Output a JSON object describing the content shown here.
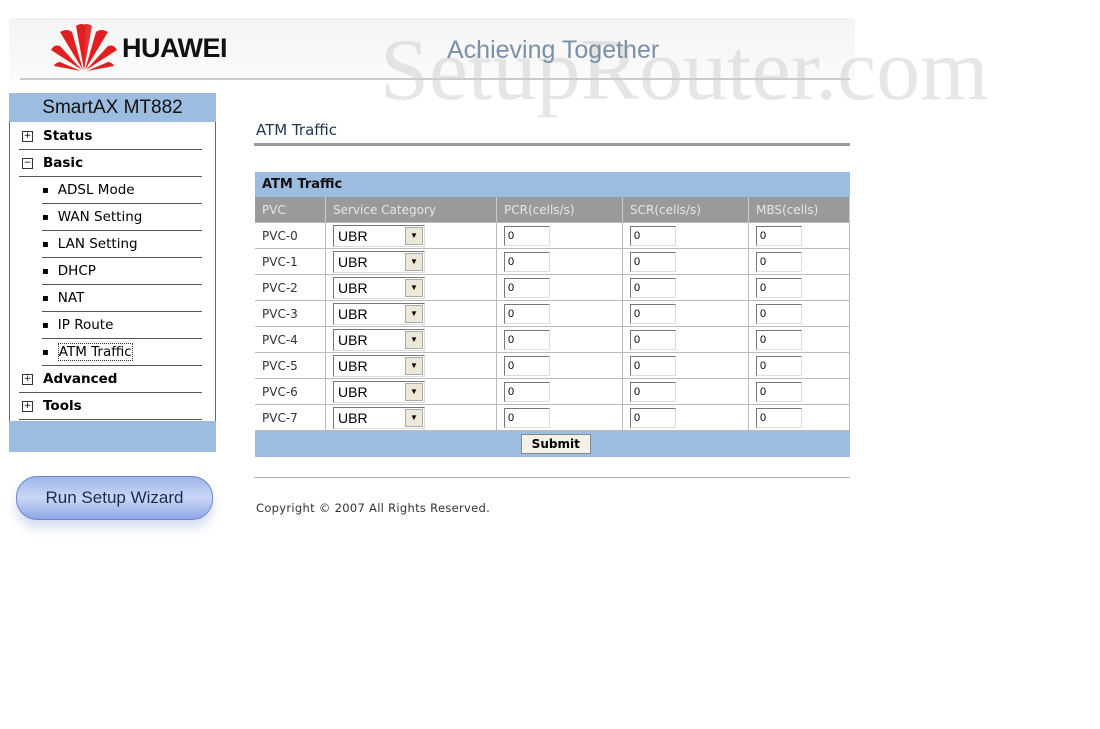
{
  "header": {
    "brand": "HUAWEI",
    "slogan": "Achieving Together",
    "watermark": "SetupRouter.com",
    "logo_color": "#e02020"
  },
  "sidebar": {
    "title": "SmartAX MT882",
    "items": [
      {
        "label": "Status",
        "icon": "plus",
        "type": "top"
      },
      {
        "label": "Basic",
        "icon": "minus",
        "type": "top"
      },
      {
        "label": "ADSL Mode",
        "type": "sub"
      },
      {
        "label": "WAN Setting",
        "type": "sub"
      },
      {
        "label": "LAN Setting",
        "type": "sub"
      },
      {
        "label": "DHCP",
        "type": "sub"
      },
      {
        "label": "NAT",
        "type": "sub"
      },
      {
        "label": "IP Route",
        "type": "sub"
      },
      {
        "label": "ATM Traffic",
        "type": "sub",
        "active": true
      },
      {
        "label": "Advanced",
        "icon": "plus",
        "type": "top"
      },
      {
        "label": "Tools",
        "icon": "plus",
        "type": "top"
      }
    ],
    "wizard_label": "Run Setup Wizard"
  },
  "main": {
    "title": "ATM Traffic",
    "table": {
      "caption": "ATM Traffic",
      "headers": [
        "PVC",
        "Service Category",
        "PCR(cells/s)",
        "SCR(cells/s)",
        "MBS(cells)"
      ],
      "rows": [
        {
          "pvc": "PVC-0",
          "category": "UBR",
          "pcr": "0",
          "scr": "0",
          "mbs": "0"
        },
        {
          "pvc": "PVC-1",
          "category": "UBR",
          "pcr": "0",
          "scr": "0",
          "mbs": "0"
        },
        {
          "pvc": "PVC-2",
          "category": "UBR",
          "pcr": "0",
          "scr": "0",
          "mbs": "0"
        },
        {
          "pvc": "PVC-3",
          "category": "UBR",
          "pcr": "0",
          "scr": "0",
          "mbs": "0"
        },
        {
          "pvc": "PVC-4",
          "category": "UBR",
          "pcr": "0",
          "scr": "0",
          "mbs": "0"
        },
        {
          "pvc": "PVC-5",
          "category": "UBR",
          "pcr": "0",
          "scr": "0",
          "mbs": "0"
        },
        {
          "pvc": "PVC-6",
          "category": "UBR",
          "pcr": "0",
          "scr": "0",
          "mbs": "0"
        },
        {
          "pvc": "PVC-7",
          "category": "UBR",
          "pcr": "0",
          "scr": "0",
          "mbs": "0"
        }
      ]
    },
    "submit_label": "Submit"
  },
  "footer": {
    "copyright": "Copyright © 2007 All Rights Reserved."
  }
}
